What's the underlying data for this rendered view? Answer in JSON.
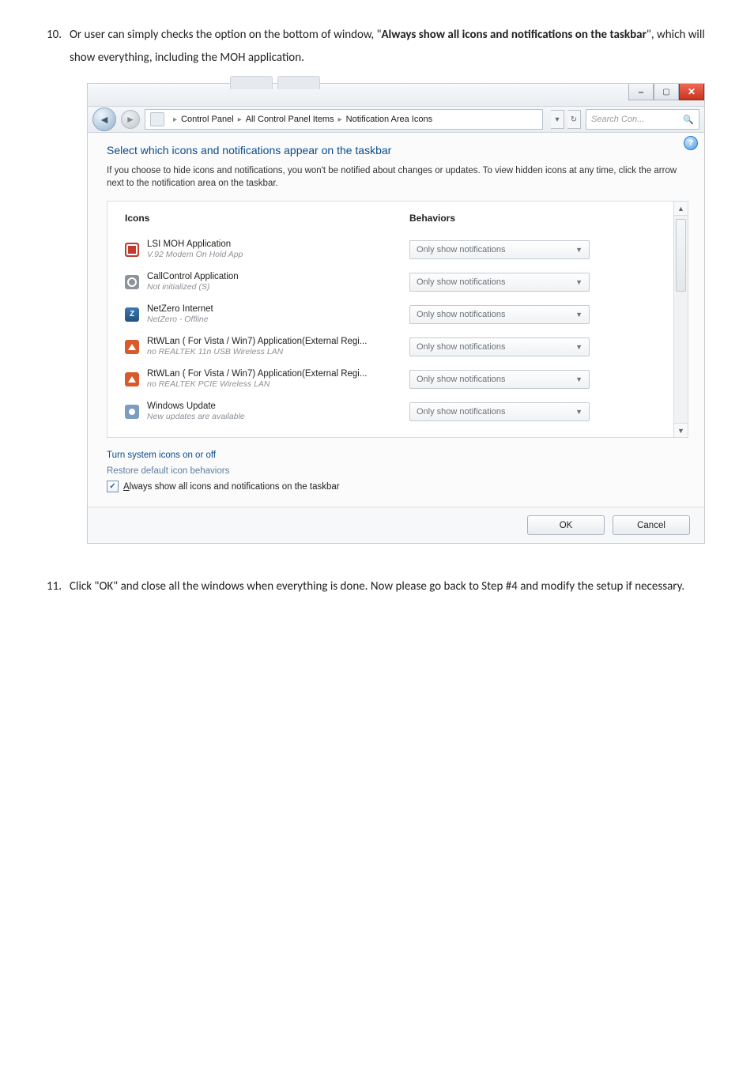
{
  "step10": {
    "num": "10.",
    "pre": "Or user can simply checks the option on the bottom of window, \"",
    "bold": "Always show all icons and notifications on the taskbar",
    "post": "\", which will show everything, including the MOH application."
  },
  "step11": {
    "num": "11.",
    "text": "Click \"OK\" and close all the windows when everything is done.    Now please go back to Step #4 and modify the setup if necessary."
  },
  "crumbs": {
    "a": "Control Panel",
    "b": "All Control Panel Items",
    "c": "Notification Area Icons"
  },
  "search_placeholder": "Search Con...",
  "heading": "Select which icons and notifications appear on the taskbar",
  "description": "If you choose to hide icons and notifications, you won't be notified about changes or updates. To view hidden icons at any time, click the arrow next to the notification area on the taskbar.",
  "col1": "Icons",
  "col2": "Behaviors",
  "behavior_value": "Only show notifications",
  "rows": [
    {
      "icon": "red",
      "t1": "LSI MOH Application",
      "t2": "V.92 Modem On Hold App"
    },
    {
      "icon": "grey",
      "t1": "CallControl Application",
      "t2": "Not initialized (S)"
    },
    {
      "icon": "nz",
      "t1": "NetZero Internet",
      "t2": "NetZero - Offline"
    },
    {
      "icon": "rt",
      "t1": "RtWLan ( For Vista / Win7) Application(External Regi...",
      "t2": "no REALTEK 11n USB Wireless LAN"
    },
    {
      "icon": "rt",
      "t1": "RtWLan ( For Vista / Win7) Application(External Regi...",
      "t2": "no REALTEK PCIE Wireless LAN"
    },
    {
      "icon": "wu",
      "t1": "Windows Update",
      "t2": "New updates are available"
    }
  ],
  "link_toggle": "Turn system icons on or off",
  "link_restore": "Restore default icon behaviors",
  "checkbox_label_pre": "A",
  "checkbox_label_rest": "lways show all icons and notifications on the taskbar",
  "ok": "OK",
  "cancel": "Cancel"
}
